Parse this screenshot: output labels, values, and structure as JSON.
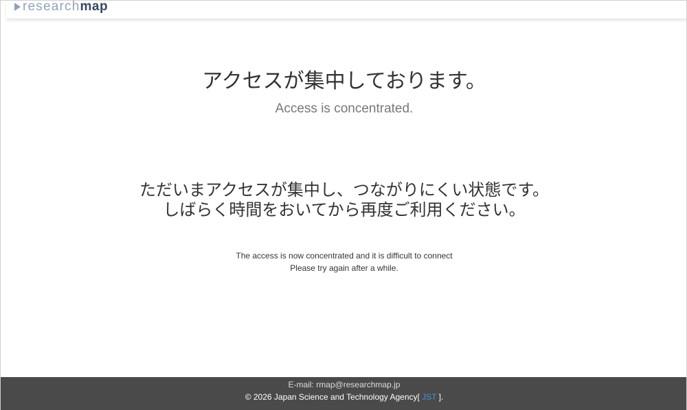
{
  "header": {
    "logo_part1": "research",
    "logo_part2": "map",
    "logo_mark_icon": "triangle-play-icon",
    "colors": {
      "logo_light": "#8fa3b8",
      "logo_dark": "#35495e"
    }
  },
  "main": {
    "title_ja": "アクセスが集中しております。",
    "title_en": "Access is concentrated.",
    "message_ja": [
      "ただいまアクセスが集中し、つながりにくい状態です。",
      "しばらく時間をおいてから再度ご利用ください。"
    ],
    "message_en": [
      "The access is now concentrated and it is difficult to connect",
      "Please try again after a while."
    ]
  },
  "footer": {
    "email_text": "E-mail: rmap@researchmap.jp",
    "copyright_text": "© 2026 Japan Science and Technology Agency[",
    "jst_link": " JST ",
    "copyright_suffix": "].",
    "colors": {
      "background": "#4a4a4a",
      "link": "#4a90d9"
    }
  }
}
